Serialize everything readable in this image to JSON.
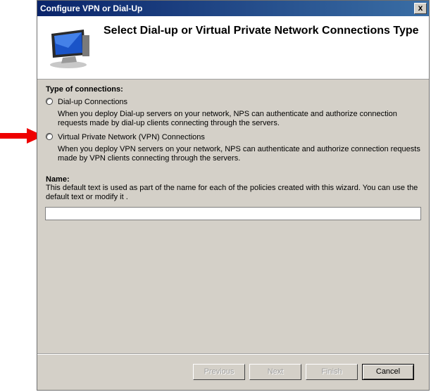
{
  "window": {
    "title": "Configure VPN or Dial-Up",
    "close_glyph": "x"
  },
  "header": {
    "title": "Select Dial-up or Virtual Private Network Connections Type",
    "icon": "monitor-network-icon"
  },
  "connections": {
    "label": "Type of connections:",
    "options": [
      {
        "label": "Dial-up Connections",
        "description": "When you deploy Dial-up servers on your network, NPS can authenticate and authorize connection requests made by dial-up clients connecting through the servers.",
        "selected": false
      },
      {
        "label": "Virtual Private Network (VPN) Connections",
        "description": "When you deploy VPN servers on your network, NPS can authenticate and authorize connection requests made by VPN clients connecting through the servers.",
        "selected": false
      }
    ]
  },
  "name": {
    "label": "Name:",
    "description": "This default text is used as part of the name for each of the policies created with this wizard. You can use the default text or modify it .",
    "value": ""
  },
  "buttons": {
    "previous": "Previous",
    "next": "Next",
    "finish": "Finish",
    "cancel": "Cancel"
  },
  "colors": {
    "titlebar": "#0a246a",
    "dialog_bg": "#d4d0c8",
    "arrow": "#ee0000"
  }
}
